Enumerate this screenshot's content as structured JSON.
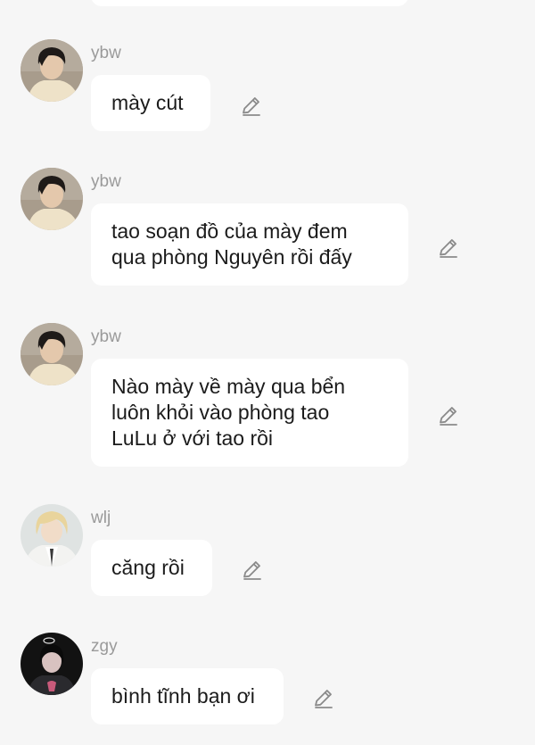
{
  "messages": [
    {
      "sender": "ybw",
      "avatar": "ybw-avatar",
      "text": "mày cút"
    },
    {
      "sender": "ybw",
      "avatar": "ybw-avatar",
      "text": "tao soạn đồ của mày đem\nqua phòng Nguyên rồi đấy"
    },
    {
      "sender": "ybw",
      "avatar": "ybw-avatar",
      "text": "Nào mày về mày qua bển\nluôn khỏi vào phòng tao\nLuLu ở với tao rồi"
    },
    {
      "sender": "wlj",
      "avatar": "wlj-avatar",
      "text": "căng rồi"
    },
    {
      "sender": "zgy",
      "avatar": "zgy-avatar",
      "text": "bình tĩnh bạn ơi"
    }
  ],
  "icons": {
    "edit": "pencil-edit-icon"
  },
  "colors": {
    "background": "#f6f6f6",
    "bubble": "#ffffff",
    "sender_name": "#9a9a9a",
    "message_text": "#1b1b1b",
    "icon": "#8a8a8a"
  }
}
